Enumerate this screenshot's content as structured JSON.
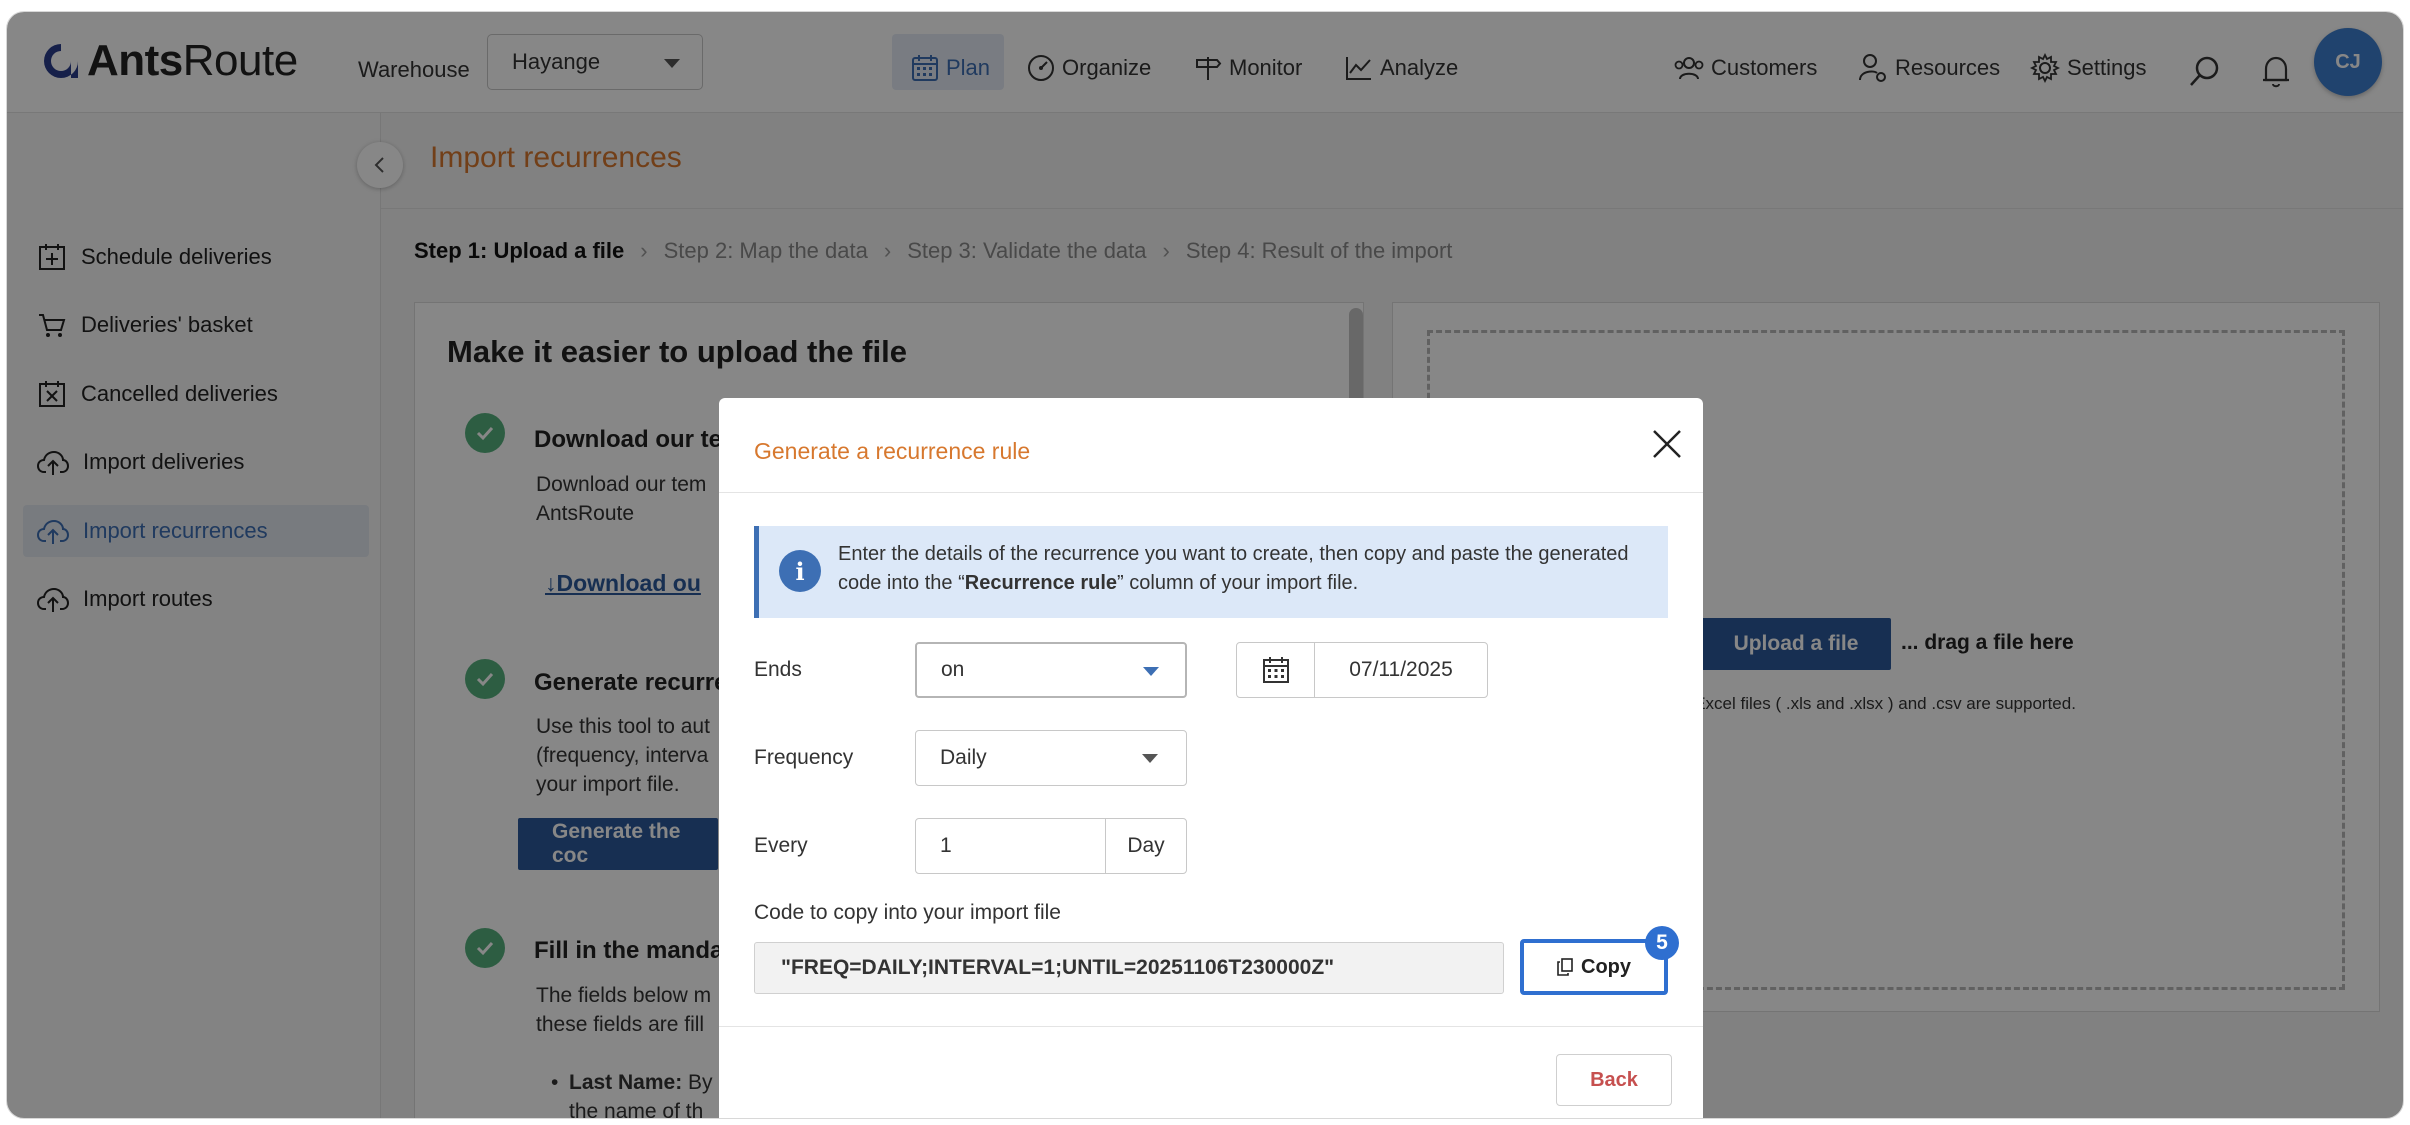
{
  "brand": {
    "name_bold": "Ants",
    "name_light": "Route"
  },
  "topbar": {
    "warehouse_label": "Warehouse",
    "warehouse_value": "Hayange",
    "nav": [
      {
        "label": "Plan",
        "icon": "calendar-icon",
        "active": true
      },
      {
        "label": "Organize",
        "icon": "dashboard-gauge-icon"
      },
      {
        "label": "Monitor",
        "icon": "signpost-icon"
      },
      {
        "label": "Analyze",
        "icon": "chart-icon"
      }
    ],
    "right_nav": [
      {
        "label": "Customers",
        "icon": "users-icon"
      },
      {
        "label": "Resources",
        "icon": "user-gear-icon"
      },
      {
        "label": "Settings",
        "icon": "gear-icon"
      }
    ],
    "avatar_initials": "CJ"
  },
  "sidebar": {
    "items": [
      {
        "label": "Schedule deliveries",
        "icon": "calendar-plus-icon"
      },
      {
        "label": "Deliveries' basket",
        "icon": "basket-icon"
      },
      {
        "label": "Cancelled deliveries",
        "icon": "calendar-x-icon"
      },
      {
        "label": "Import deliveries",
        "icon": "cloud-upload-icon"
      },
      {
        "label": "Import recurrences",
        "icon": "cloud-upload-icon",
        "active": true
      },
      {
        "label": "Import routes",
        "icon": "cloud-upload-icon"
      }
    ]
  },
  "page": {
    "title": "Import recurrences",
    "steps": [
      "Step 1: Upload a file",
      "Step 2: Map the data",
      "Step 3: Validate the data",
      "Step 4: Result of the import"
    ],
    "left_card": {
      "title": "Make it easier to upload the file",
      "step1_heading": "Download our te",
      "step1_text_line1": "Download our tem",
      "step1_text_line2": "AntsRoute",
      "download_link": "Download ou",
      "step2_heading": "Generate recurre",
      "step2_text_line1": "Use this tool to aut",
      "step2_text_line2": "(frequency, interva",
      "step2_text_line3": "your import file.",
      "generate_button": "Generate the coc",
      "step3_heading": "Fill in the manda",
      "step3_text_line1": "The fields below m",
      "step3_text_line2": "these fields are fill",
      "bullet_bold": "Last Name:",
      "bullet_text": " By",
      "bullet_line2": "the name of th"
    },
    "right_card": {
      "upload_button": "Upload a file",
      "drag_text": "... drag a file here",
      "support_text": "y Excel files ( .xls and .xlsx ) and .csv are supported."
    }
  },
  "modal": {
    "title": "Generate a recurrence rule",
    "info_pre": "Enter the details of the recurrence you want to create, then copy and paste the generated code into the “",
    "info_bold": "Recurrence rule",
    "info_post": "” column of your import file.",
    "ends_label": "Ends",
    "ends_value": "on",
    "end_date": "07/11/2025",
    "frequency_label": "Frequency",
    "frequency_value": "Daily",
    "every_label": "Every",
    "every_value": "1",
    "every_unit": "Day",
    "code_label": "Code to copy into your import file",
    "code_value": "\"FREQ=DAILY;INTERVAL=1;UNTIL=20251106T230000Z\"",
    "copy_label": "Copy",
    "copy_badge": "5",
    "back_label": "Back"
  },
  "colors": {
    "accent_orange": "#d7782e",
    "primary_blue": "#2d5a9b",
    "success_green": "#55b07d",
    "focus_blue": "#2f6fd0",
    "danger_red": "#c6504f"
  }
}
